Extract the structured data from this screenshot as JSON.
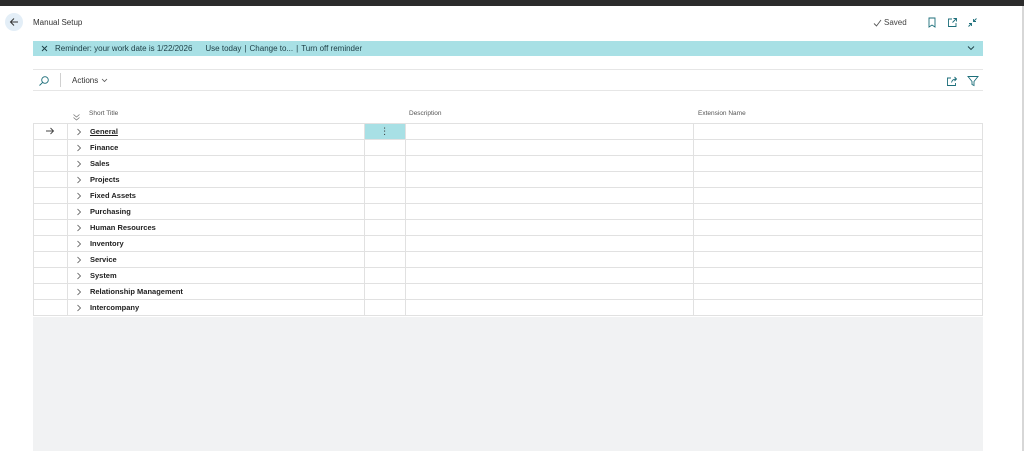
{
  "header": {
    "page_title": "Manual Setup",
    "saved_label": "Saved"
  },
  "banner": {
    "message": "Reminder: your work date is 1/22/2026",
    "links": [
      "Use today",
      "Change to...",
      "Turn off reminder"
    ]
  },
  "toolbar": {
    "actions_label": "Actions"
  },
  "columns": {
    "short_title": "Short Title",
    "description": "Description",
    "extension_name": "Extension Name"
  },
  "rows": [
    {
      "title": "General",
      "description": "",
      "extension": ""
    },
    {
      "title": "Finance",
      "description": "",
      "extension": ""
    },
    {
      "title": "Sales",
      "description": "",
      "extension": ""
    },
    {
      "title": "Projects",
      "description": "",
      "extension": ""
    },
    {
      "title": "Fixed Assets",
      "description": "",
      "extension": ""
    },
    {
      "title": "Purchasing",
      "description": "",
      "extension": ""
    },
    {
      "title": "Human Resources",
      "description": "",
      "extension": ""
    },
    {
      "title": "Inventory",
      "description": "",
      "extension": ""
    },
    {
      "title": "Service",
      "description": "",
      "extension": ""
    },
    {
      "title": "System",
      "description": "",
      "extension": ""
    },
    {
      "title": "Relationship Management",
      "description": "",
      "extension": ""
    },
    {
      "title": "Intercompany",
      "description": "",
      "extension": ""
    }
  ],
  "selected_row": 0,
  "icons": {
    "back": "arrow-left-icon",
    "saved": "checkmark-icon",
    "bookmark": "bookmark-icon",
    "open_new_window": "open-in-new-window-icon",
    "collapse": "collapse-icon",
    "dismiss": "close-icon",
    "banner_toggle": "chevron-down-icon",
    "search": "search-icon",
    "share": "share-icon",
    "filter": "filter-icon",
    "row_pointer": "arrow-right-icon",
    "row_expand": "chevron-right-icon",
    "row_menu": "more-options-icon"
  },
  "colors": {
    "accent": "#a8e0e5",
    "link": "#1c6e7a",
    "grid_background": "#f1f2f3"
  }
}
